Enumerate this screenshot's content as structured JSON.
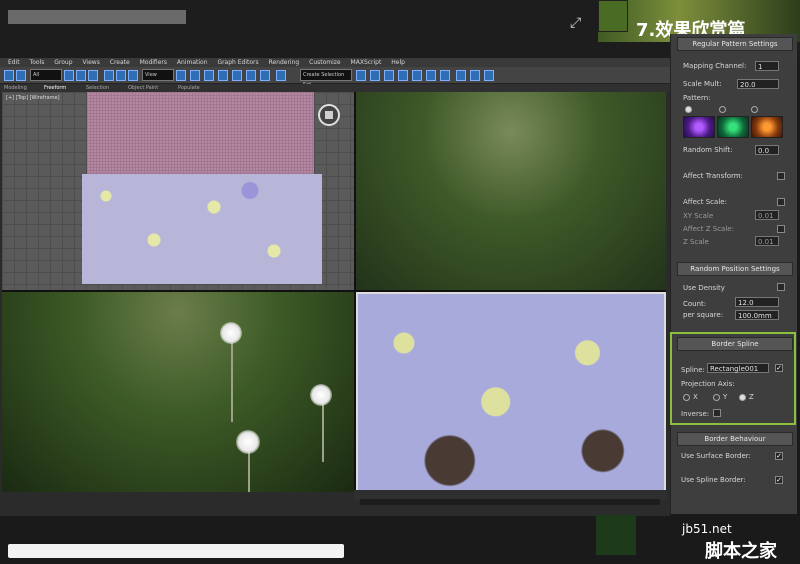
{
  "header": {
    "section_title": "7.效果欣赏篇"
  },
  "menubar": [
    "Edit",
    "Tools",
    "Group",
    "Views",
    "Create",
    "Modifiers",
    "Animation",
    "Graph Editors",
    "Rendering",
    "Customize",
    "MAXScript",
    "Help"
  ],
  "toolbar": {
    "selection_filter": "All",
    "view_dropdown": "View",
    "named_selection": "Create Selection Set"
  },
  "ribbon_tabs": [
    "Modeling",
    "Freeform",
    "Selection",
    "Object Paint",
    "Populate"
  ],
  "viewport_label": "[+] [Top] [Wireframe]",
  "panel": {
    "regular_pattern": {
      "title": "Regular Pattern Settings",
      "mapping_channel_label": "Mapping Channel:",
      "mapping_channel_value": "1",
      "scale_mult_label": "Scale Mult:",
      "scale_mult_value": "20.0",
      "pattern_label": "Pattern:",
      "random_shift_label": "Random Shift:",
      "random_shift_value": "0.0",
      "affect_transform_label": "Affect Transform:",
      "affect_scale_label": "Affect Scale:",
      "xy_scale_label": "XY Scale",
      "xy_scale_value": "0.01",
      "affect_z_scale_label": "Affect Z Scale:",
      "z_scale_label": "Z Scale",
      "z_scale_value": "0.01"
    },
    "random_position": {
      "title": "Random Position Settings",
      "use_density_label": "Use Density",
      "count_label": "Count:",
      "count_value": "12.0",
      "per_square_label": "per square:",
      "per_square_value": "100.0mm"
    },
    "border_spline": {
      "title": "Border Spline",
      "spline_label": "Spline:",
      "spline_value": "Rectangle001",
      "projection_axis_label": "Projection Axis:",
      "axis_x": "X",
      "axis_y": "Y",
      "axis_z": "Z",
      "inverse_label": "Inverse:"
    },
    "border_behaviour": {
      "title": "Border Behaviour",
      "use_surface_border_label": "Use Surface Border:",
      "use_spline_border_label": "Use Spline Border:"
    }
  },
  "watermark": {
    "site": "jb51.net",
    "name": "脚本之家"
  },
  "icons": [
    "expand-icon",
    "viewcube-nav-icon",
    "checkmark-icon"
  ]
}
